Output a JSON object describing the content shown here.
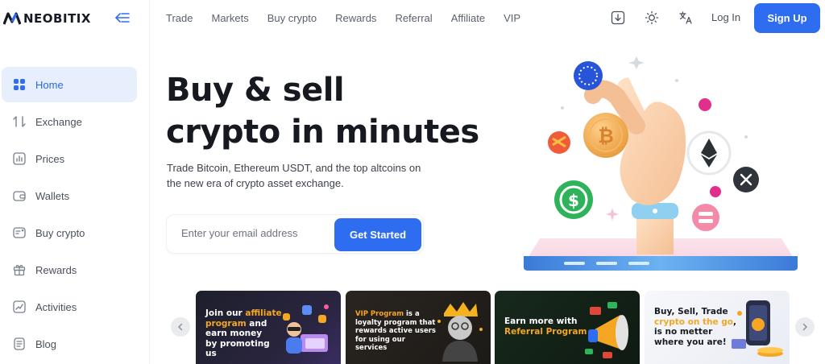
{
  "brand": {
    "name": "NEOBITIX"
  },
  "topnav": {
    "links": [
      "Trade",
      "Markets",
      "Buy crypto",
      "Rewards",
      "Referral",
      "Affiliate",
      "VIP"
    ],
    "login": "Log In",
    "signup": "Sign Up"
  },
  "sidebar": {
    "items": [
      {
        "label": "Home",
        "icon": "grid-icon",
        "active": true
      },
      {
        "label": "Exchange",
        "icon": "exchange-arrows-icon"
      },
      {
        "label": "Prices",
        "icon": "bar-chart-icon"
      },
      {
        "label": "Wallets",
        "icon": "wallet-icon"
      },
      {
        "label": "Buy crypto",
        "icon": "card-icon"
      },
      {
        "label": "Rewards",
        "icon": "gift-icon"
      },
      {
        "label": "Activities",
        "icon": "activity-chart-icon"
      },
      {
        "label": "Blog",
        "icon": "document-icon"
      }
    ]
  },
  "hero": {
    "title_line1": "Buy & sell",
    "title_line2": "crypto in minutes",
    "subtitle": "Trade Bitcoin, Ethereum USDT, and the top altcoins on the new era of crypto asset exchange.",
    "email_placeholder": "Enter your email address",
    "cta": "Get Started"
  },
  "promos": [
    {
      "lines": [
        "Join our ",
        "affiliate",
        " program",
        " and",
        "earn money",
        "by promoting us"
      ],
      "highlight": "affiliate program"
    },
    {
      "lines": [
        "VIP Program",
        " is a",
        "loyalty program that",
        "rewards active users",
        "for using our services"
      ]
    },
    {
      "lines": [
        "Earn more with",
        "Referral Program"
      ]
    },
    {
      "lines": [
        "Buy, Sell, Trade",
        "crypto on the go",
        ",",
        "is no metter",
        "where you are!"
      ]
    }
  ],
  "colors": {
    "accent": "#2f6df0",
    "active_bg": "#e8effc",
    "promo_highlight": "#f5a623"
  }
}
